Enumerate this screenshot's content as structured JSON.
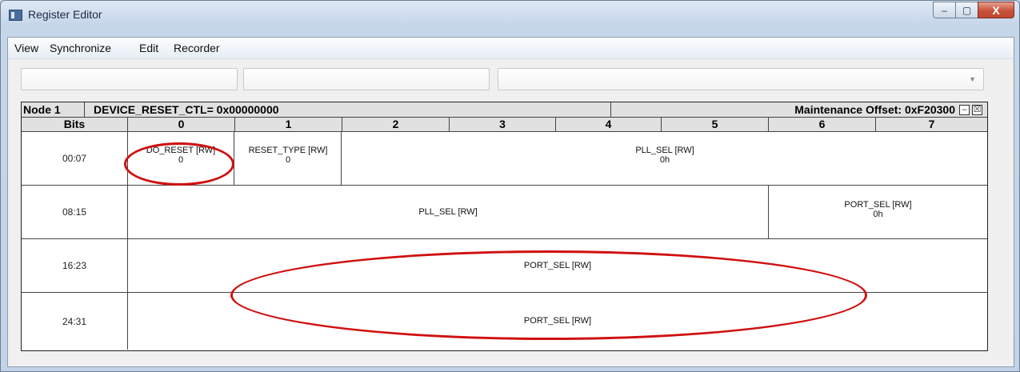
{
  "window": {
    "title": "Register Editor",
    "min": "–",
    "max": "▢",
    "close": "X"
  },
  "menu": {
    "view": "View",
    "synchronize": "Synchronize",
    "edit": "Edit",
    "recorder": "Recorder"
  },
  "header": {
    "node": "Node 1",
    "register": "DEVICE_RESET_CTL= 0x00000000",
    "offset": "Maintenance Offset: 0xF20300",
    "minimize_glyph": "–",
    "close_glyph": "☒"
  },
  "columns": {
    "bits": "Bits",
    "c0": "0",
    "c1": "1",
    "c2": "2",
    "c3": "3",
    "c4": "4",
    "c5": "5",
    "c6": "6",
    "c7": "7"
  },
  "rows": {
    "r0": {
      "bits": "00:07",
      "do_reset": {
        "name": "DO_RESET [RW]",
        "value": "0"
      },
      "reset_type": {
        "name": "RESET_TYPE [RW]",
        "value": "0"
      },
      "pll_sel": {
        "name": "PLL_SEL [RW]",
        "value": "0h"
      }
    },
    "r1": {
      "bits": "08:15",
      "pll_sel": {
        "name": "PLL_SEL [RW]"
      },
      "port_sel": {
        "name": "PORT_SEL [RW]",
        "value": "0h"
      }
    },
    "r2": {
      "bits": "16:23",
      "port_sel": {
        "name": "PORT_SEL [RW]"
      }
    },
    "r3": {
      "bits": "24:31",
      "port_sel": {
        "name": "PORT_SEL [RW]"
      }
    }
  },
  "annotation_color": "#d01010"
}
